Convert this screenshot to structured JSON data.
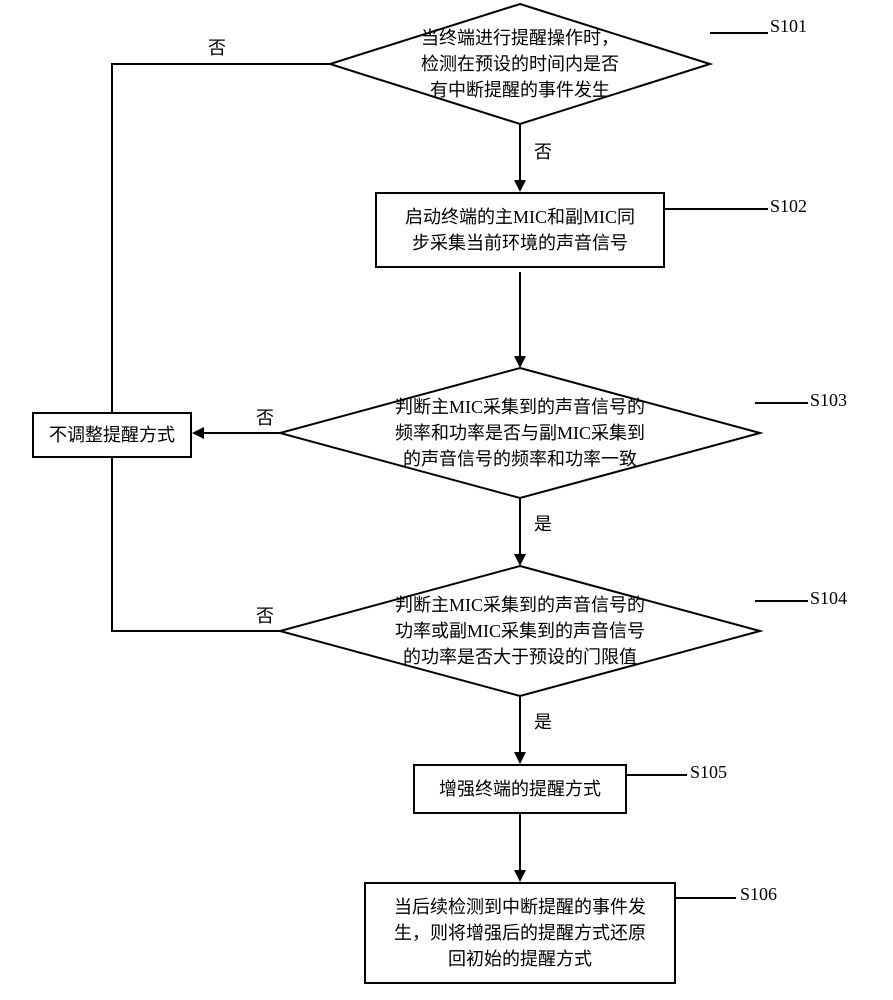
{
  "nodes": {
    "s101": {
      "text": "当终端进行提醒操作时，\n检测在预设的时间内是否\n有中断提醒的事件发生",
      "label": "S101"
    },
    "s102": {
      "text": "启动终端的主MIC和副MIC同\n步采集当前环境的声音信号",
      "label": "S102"
    },
    "s103": {
      "text": "判断主MIC采集到的声音信号的\n频率和功率是否与副MIC采集到\n的声音信号的频率和功率一致",
      "label": "S103"
    },
    "s104": {
      "text": "判断主MIC采集到的声音信号的\n功率或副MIC采集到的声音信号\n的功率是否大于预设的门限值",
      "label": "S104"
    },
    "s105": {
      "text": "增强终端的提醒方式",
      "label": "S105"
    },
    "s106": {
      "text": "当后续检测到中断提醒的事件发\n生，则将增强后的提醒方式还原\n回初始的提醒方式",
      "label": "S106"
    },
    "noAdjust": {
      "text": "不调整提醒方式"
    }
  },
  "edges": {
    "yes": "是",
    "no": "否"
  },
  "chart_data": {
    "type": "flowchart",
    "nodes": [
      {
        "id": "S101",
        "shape": "diamond",
        "text": "当终端进行提醒操作时，检测在预设的时间内是否有中断提醒的事件发生"
      },
      {
        "id": "S102",
        "shape": "rect",
        "text": "启动终端的主MIC和副MIC同步采集当前环境的声音信号"
      },
      {
        "id": "S103",
        "shape": "diamond",
        "text": "判断主MIC采集到的声音信号的频率和功率是否与副MIC采集到的声音信号的频率和功率一致"
      },
      {
        "id": "S104",
        "shape": "diamond",
        "text": "判断主MIC采集到的声音信号的功率或副MIC采集到的声音信号的功率是否大于预设的门限值"
      },
      {
        "id": "S105",
        "shape": "rect",
        "text": "增强终端的提醒方式"
      },
      {
        "id": "S106",
        "shape": "rect",
        "text": "当后续检测到中断提醒的事件发生，则将增强后的提醒方式还原回初始的提醒方式"
      },
      {
        "id": "NoAdjust",
        "shape": "rect",
        "text": "不调整提醒方式"
      }
    ],
    "edges": [
      {
        "from": "S101",
        "to": "S102",
        "label": "否"
      },
      {
        "from": "S101",
        "to": "NoAdjust",
        "label": "否",
        "note": "left-branch via bar"
      },
      {
        "from": "S102",
        "to": "S103"
      },
      {
        "from": "S103",
        "to": "S104",
        "label": "是"
      },
      {
        "from": "S103",
        "to": "NoAdjust",
        "label": "否"
      },
      {
        "from": "S104",
        "to": "S105",
        "label": "是"
      },
      {
        "from": "S104",
        "to": "NoAdjust",
        "label": "否",
        "note": "via bar"
      },
      {
        "from": "S105",
        "to": "S106"
      }
    ]
  }
}
